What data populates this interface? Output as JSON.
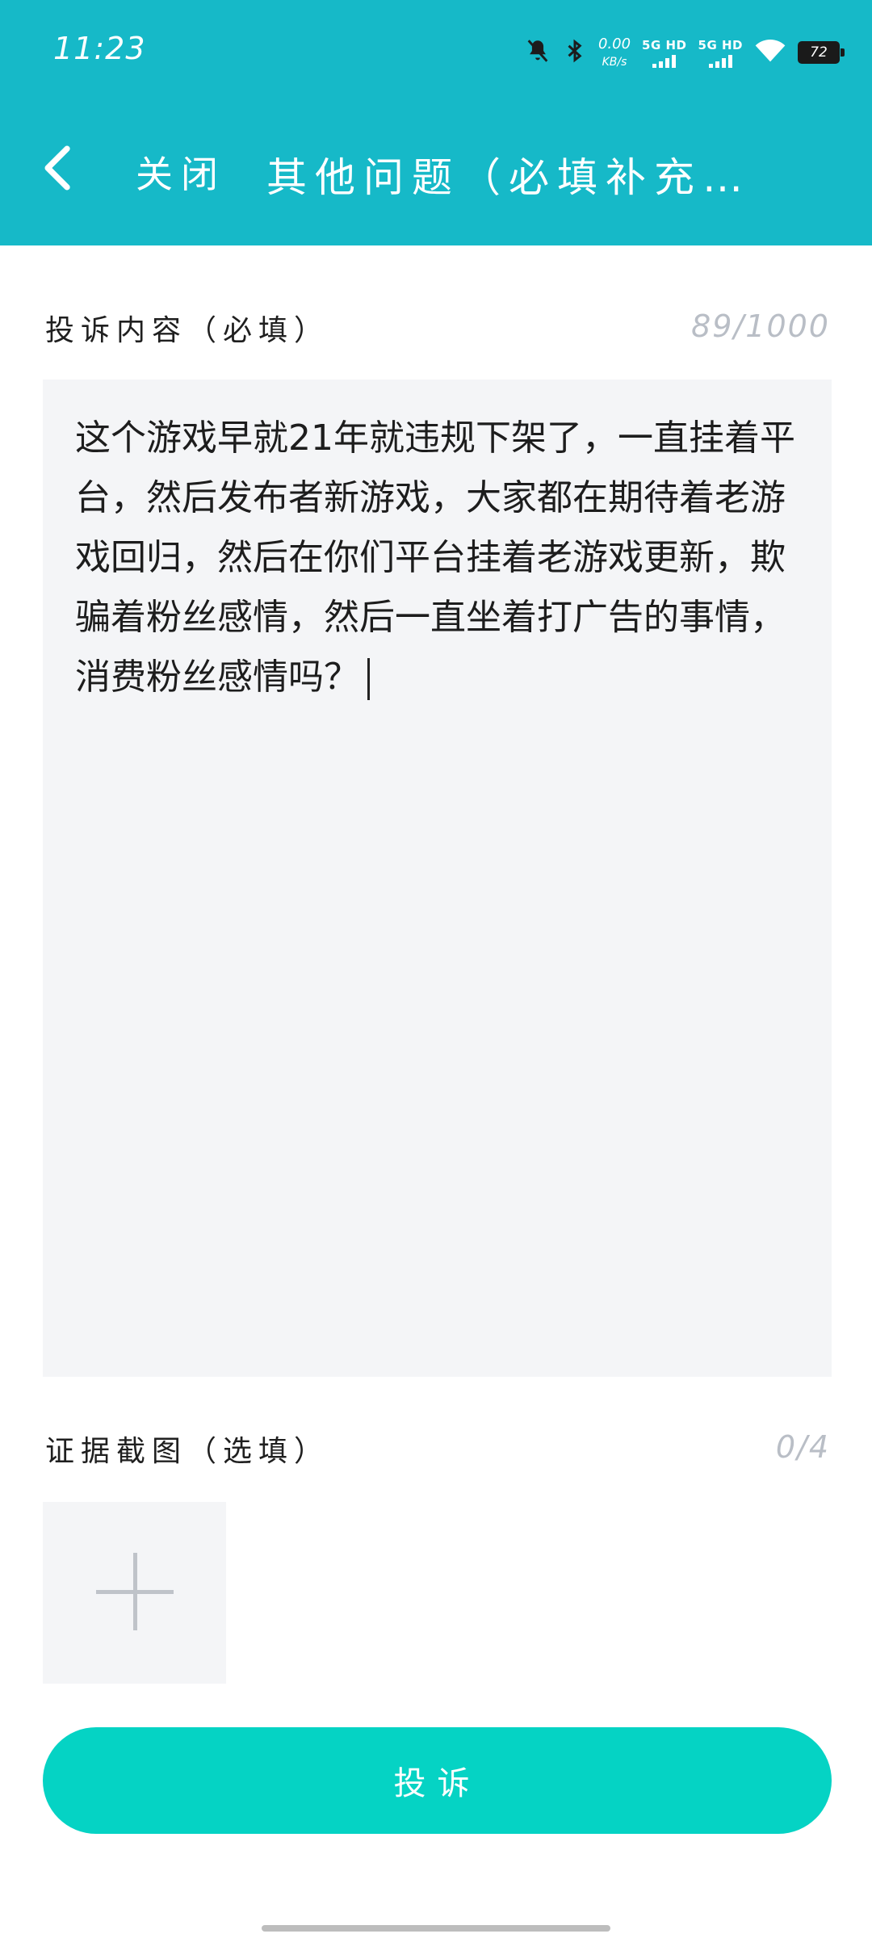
{
  "status_bar": {
    "time": "11:23",
    "net_speed_value": "0.00",
    "net_speed_unit": "KB/s",
    "sim1_label": "5G HD",
    "sim2_label": "5G HD",
    "battery_level": "72",
    "icons": [
      "mute-bell-icon",
      "bluetooth-icon",
      "signal-icon",
      "wifi-icon",
      "battery-icon"
    ]
  },
  "header": {
    "back_icon": "chevron-left-icon",
    "close_label": "关闭",
    "title": "其他问题（必填补充…"
  },
  "complaint": {
    "label": "投诉内容（必填）",
    "counter": "89/1000",
    "text": "这个游戏早就21年就违规下架了，一直挂着平台，然后发布者新游戏，大家都在期待着老游戏回归，然后在你们平台挂着老游戏更新，欺骗着粉丝感情，然后一直坐着打广告的事情，消费粉丝感情吗？"
  },
  "evidence": {
    "label": "证据截图（选填）",
    "counter": "0/4",
    "add_icon": "plus-icon"
  },
  "submit_label": "投诉",
  "colors": {
    "header_bg": "#16b9c8",
    "button_bg": "#05d3c4",
    "field_bg": "#f4f5f7",
    "counter_text": "#b9bec6"
  }
}
